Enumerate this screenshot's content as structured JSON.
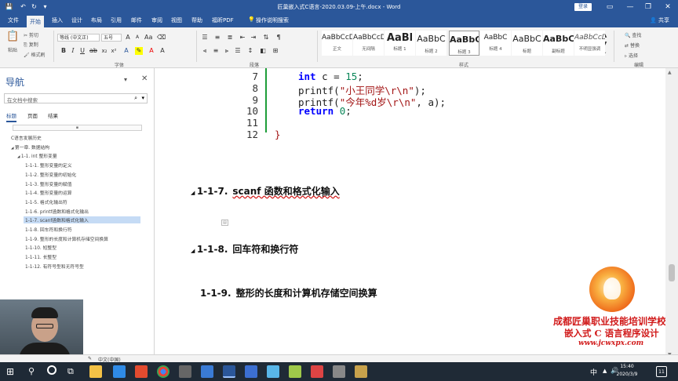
{
  "title": "匠巢嵌入式C语言-2020.03.09-上午.docx - Word",
  "login_label": "登录",
  "share_label": "共享",
  "window_controls": [
    "▭",
    "—",
    "❐",
    "✕"
  ],
  "tabs": [
    "文件",
    "开始",
    "插入",
    "设计",
    "布局",
    "引用",
    "邮件",
    "审阅",
    "视图",
    "帮助",
    "福昕PDF"
  ],
  "tell_me": "操作说明搜索",
  "clipboard": {
    "paste": "粘贴",
    "cut": "剪切",
    "copy": "复制",
    "format_painter": "格式刷"
  },
  "font": {
    "name": "等线 (中文正)",
    "size": "五号",
    "group_label": "字体"
  },
  "paragraph_label": "段落",
  "styles_label": "样式",
  "editing": {
    "find": "查找",
    "replace": "替换",
    "select": "选择",
    "label": "编辑"
  },
  "styles": [
    {
      "sample": "AaBbCcDı",
      "name": "正文"
    },
    {
      "sample": "AaBbCcDı",
      "name": "无间隔"
    },
    {
      "sample": "AaBl",
      "name": "标题 1"
    },
    {
      "sample": "AaBbC",
      "name": "标题 2"
    },
    {
      "sample": "AaBbC",
      "name": "标题 3"
    },
    {
      "sample": "AaBbC",
      "name": "标题 4"
    },
    {
      "sample": "AaBbC",
      "name": "标题"
    },
    {
      "sample": "AaBbC",
      "name": "副标题"
    },
    {
      "sample": "AaBbCcDı",
      "name": "不明显强调"
    }
  ],
  "nav": {
    "title": "导航",
    "search_placeholder": "在文档中搜索",
    "tabs": [
      "标题",
      "页面",
      "结果"
    ],
    "items": [
      {
        "text": "C语言发展历史",
        "level": 0
      },
      {
        "text": "第一章. 数据结构",
        "level": 0
      },
      {
        "text": "1-1. int 整形变量",
        "level": 1
      },
      {
        "text": "1-1-1. 整形变量的定义",
        "level": 2
      },
      {
        "text": "1-1-2. 整形变量的初始化",
        "level": 2
      },
      {
        "text": "1-1-3. 整形变量的赋值",
        "level": 2
      },
      {
        "text": "1-1-4. 整形变量的运算",
        "level": 2
      },
      {
        "text": "1-1-5. 格式化输出符",
        "level": 2
      },
      {
        "text": "1-1-6. printf函数和格式化输出",
        "level": 2
      },
      {
        "text": "1-1-7. scanf函数和格式化输入",
        "level": 2,
        "selected": true
      },
      {
        "text": "1-1-8. 回车符和换行符",
        "level": 2
      },
      {
        "text": "1-1-9. 整形的长度和计算机存储空间换算",
        "level": 2
      },
      {
        "text": "1-1-10. 短整型",
        "level": 2
      },
      {
        "text": "1-1-11. 长整型",
        "level": 2
      },
      {
        "text": "1-1-12. 有符号型和无符号型",
        "level": 2
      }
    ]
  },
  "code": {
    "lines": [
      {
        "n": "7",
        "kw": "int",
        "rest": " c = ",
        "num": "15",
        "end": ";"
      },
      {
        "n": "8",
        "pre": "printf(",
        "str": "\"小王同学\\r\\n\"",
        "end": ");"
      },
      {
        "n": "9",
        "pre": "printf(",
        "str": "\"今年%d岁\\r\\n\"",
        "end": ", a);"
      },
      {
        "n": "10",
        "kw": "return",
        "rest": " ",
        "num": "0",
        "end": ";"
      },
      {
        "n": "11"
      },
      {
        "n": "12",
        "brace": "}"
      }
    ]
  },
  "headings": [
    {
      "num": "1-1-7.",
      "text": "scanf 函数和格式化输入"
    },
    {
      "num": "1-1-8.",
      "text": "回车符和换行符"
    },
    {
      "num": "1-1-9.",
      "text": "整形的长度和计算机存储空间换算"
    }
  ],
  "watermark": {
    "line1": "成都匠巢职业技能培训学校",
    "line2": "嵌入式 C 语言程序设计",
    "url": "www.jcwxpx.com"
  },
  "status": {
    "lang": "中文(中国)"
  },
  "clock": {
    "time": "15:40",
    "date": "2020/3/9"
  },
  "tray_text": "中",
  "taskbar_badge": "11",
  "colors": {
    "word_blue": "#2b579a",
    "code_keyword": "#0000ff",
    "code_string": "#a31515",
    "watermark_red": "#d11a1a",
    "selected_nav": "#c5dbf5"
  }
}
